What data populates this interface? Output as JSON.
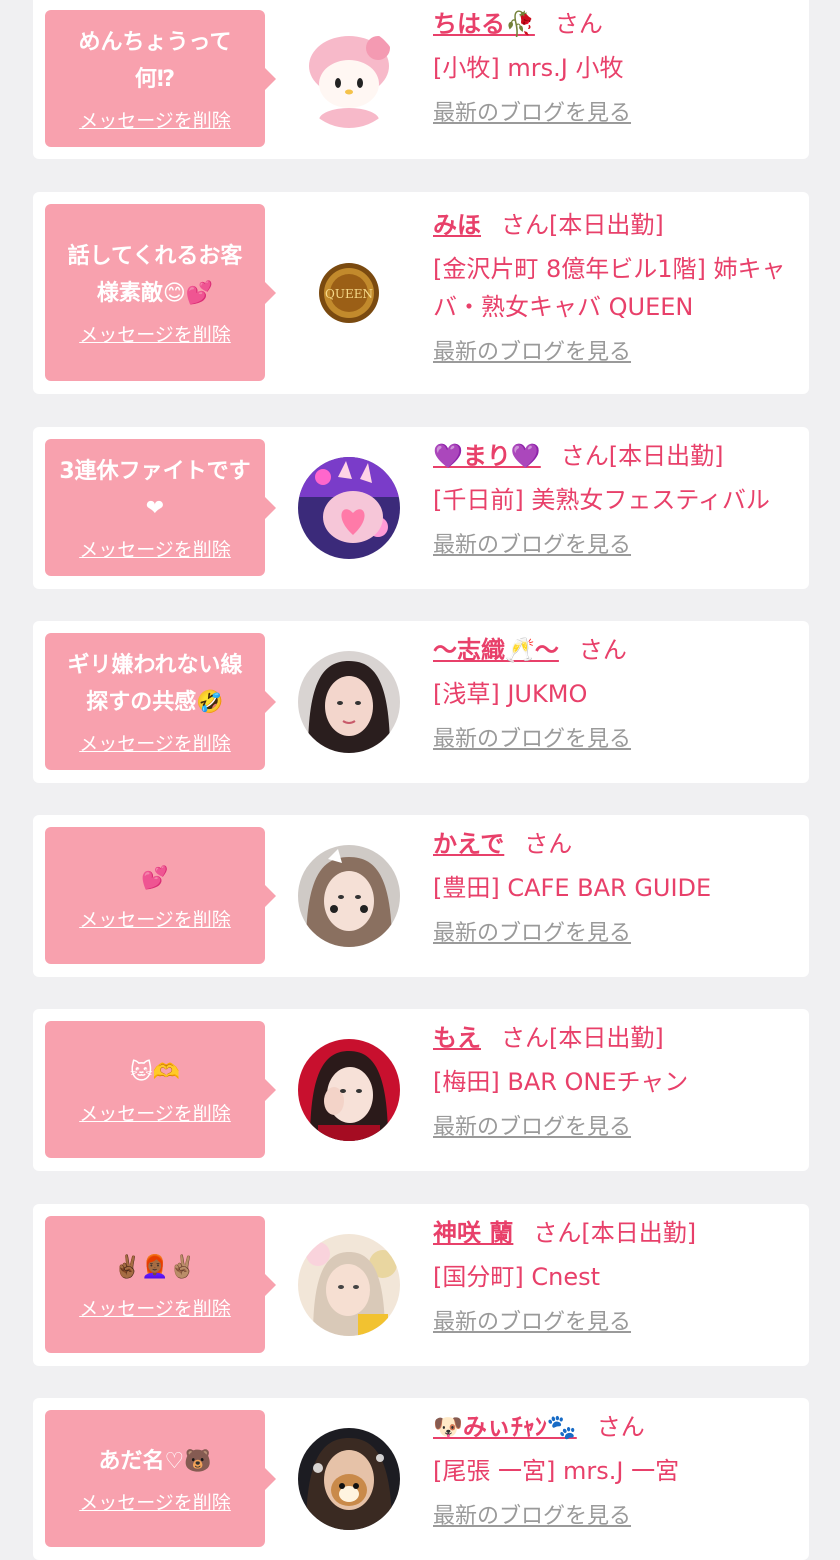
{
  "colors": {
    "accent": "#e8406a",
    "bubble": "#f8a1ae",
    "link_gray": "#9a9a9a",
    "background": "#f0f0f2"
  },
  "delete_label": "メッセージを削除",
  "blog_label": "最新のブログを見る",
  "suffix": "さん",
  "entries": [
    {
      "message": "めんちょうって\n何⁉",
      "name": "ちはる🥀",
      "status": "",
      "shop": "[小牧] mrs.J 小牧"
    },
    {
      "message": "話してくれるお客\n様素敵😊💕",
      "name": "みほ",
      "status": "[本日出勤]",
      "shop": "[金沢片町 8億年ビル1階] 姉キャバ・熟女キャバ QUEEN"
    },
    {
      "message": "3連休ファイトです\n❤",
      "name": "💜まり💜",
      "status": "[本日出勤]",
      "shop": "[千日前] 美熟女フェスティバル"
    },
    {
      "message": "ギリ嫌われない線\n探すの共感🤣",
      "name": "〜志織🥂〜",
      "status": "",
      "shop": "[浅草] JUKMO"
    },
    {
      "message": "💕",
      "name": "かえで",
      "status": "",
      "shop": "[豊田] CAFE BAR GUIDE"
    },
    {
      "message": "🐱🫶",
      "name": "もえ",
      "status": "[本日出勤]",
      "shop": "[梅田] BAR ONEチャン"
    },
    {
      "message": "✌🏾👩🏾‍🦰✌🏽",
      "name": "神咲 蘭",
      "status": "[本日出勤]",
      "shop": "[国分町] Cnest"
    },
    {
      "message": "あだ名♡🐻",
      "name": "🐶みぃﾁｬﾝ🐾",
      "status": "",
      "shop": "[尾張 一宮] mrs.J 一宮"
    }
  ]
}
